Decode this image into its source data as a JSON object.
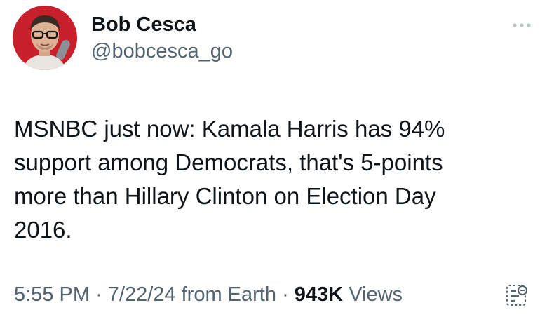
{
  "author": {
    "display_name": "Bob Cesca",
    "handle": "@bobcesca_go",
    "avatar_icon": "profile-photo"
  },
  "tweet": {
    "text": "MSNBC just now: Kamala Harris has 94%\nsupport among Democrats, that's 5-points\nmore than Hillary Clinton on Election Day\n2016."
  },
  "meta": {
    "time": "5:55 PM",
    "separator": "·",
    "date": "7/22/24",
    "source": "from Earth",
    "views_count": "943K",
    "views_label": "Views"
  },
  "icons": {
    "more": "more-horizontal-icon",
    "analytics": "analytics-icon"
  },
  "colors": {
    "text_primary": "#0f1419",
    "text_secondary": "#536471",
    "avatar_bg": "#c8202a"
  }
}
